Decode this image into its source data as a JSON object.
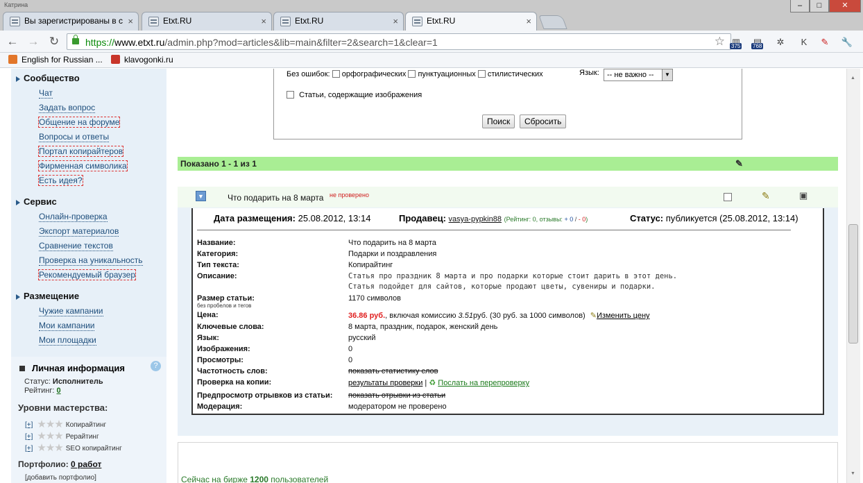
{
  "browser": {
    "window_label": "Катрина",
    "tabs": [
      {
        "title": "Вы зарегистрированы в с",
        "active": false
      },
      {
        "title": "Etxt.RU",
        "active": false
      },
      {
        "title": "Etxt.RU",
        "active": false
      },
      {
        "title": "Etxt.RU",
        "active": true
      }
    ],
    "tab_close": "×",
    "url_https": "https://",
    "url_host": "www.etxt.ru",
    "url_path": "/admin.php?mod=articles&lib=main&filter=2&search=1&clear=1",
    "ext_badges": [
      "375",
      "768"
    ],
    "bookmarks": [
      "English for Russian ...",
      "klavogonki.ru"
    ],
    "win_controls": [
      "–",
      "□",
      "✕"
    ]
  },
  "sidebar": {
    "community_title": "Сообщество",
    "community_links": [
      "Чат",
      "Задать вопрос",
      "Общение на форуме",
      "Вопросы и ответы",
      "Портал копирайтеров",
      "Фирменная символика",
      "Есть идея?"
    ],
    "service_title": "Сервис",
    "service_links": [
      "Онлайн-проверка",
      "Экспорт материалов",
      "Сравнение текстов",
      "Проверка на уникальность",
      "Рекомендуемый браузер"
    ],
    "placement_title": "Размещение",
    "placement_links": [
      "Чужие кампании",
      "Мои кампании",
      "Мои площадки"
    ],
    "personal": {
      "title": "Личная информация",
      "help": "?",
      "status_label": "Статус:",
      "status_value": "Исполнитель",
      "rating_label": "Рейтинг:",
      "rating_value": "0",
      "levels_title": "Уровни мастерства:",
      "levels": [
        {
          "plus": "[+]",
          "name": "Копирайтинг"
        },
        {
          "plus": "[+]",
          "name": "Рерайтинг"
        },
        {
          "plus": "[+]",
          "name": "SEO копирайтинг"
        }
      ],
      "portfolio_label": "Портфолио:",
      "portfolio_value": "0 работ",
      "add_portfolio": "[добавить портфолио]"
    }
  },
  "search": {
    "no_errors_label": "Без ошибок:",
    "check_spelling": "орфографических",
    "check_punct": "пунктуационных",
    "check_style": "стилистических",
    "lang_label": "Язык:",
    "lang_value": "-- не важно --",
    "images_check": "Статьи, содержащие изображения",
    "search_btn": "Поиск",
    "reset_btn": "Сбросить"
  },
  "results": {
    "shown": "Показано 1 - 1 из 1"
  },
  "article": {
    "title": "Что подарить на 8 марта",
    "not_checked": "не проверено",
    "date_label": "Дата размещения:",
    "date_value": "25.08.2012, 13:14",
    "seller_label": "Продавец:",
    "seller_name": "vasya-pypkin88",
    "seller_rating_open": "(Рейтинг: 0, отзывы: ",
    "seller_plus": "+ 0",
    "seller_sep": " / ",
    "seller_minus": "- 0",
    "seller_close": ")",
    "status_label": "Статус:",
    "status_value": "публикуется (25.08.2012, 13:14)",
    "fields": {
      "name_l": "Название:",
      "name_v": "Что подарить на 8 марта",
      "cat_l": "Категория:",
      "cat_v": "Подарки и поздравления",
      "type_l": "Тип текста:",
      "type_v": "Копирайтинг",
      "desc_l": "Описание:",
      "desc_v1": "Статья про праздник 8 марта и про подарки которые стоит дарить в этот день.",
      "desc_v2": "Статья подойдет для сайтов, которые продают цветы, сувениры и подарки.",
      "size_l": "Размер статьи:",
      "size_sub": "без пробелов и тегов",
      "size_v": "1170 символов",
      "price_l": "Цена:",
      "price_v": "36.86 руб.",
      "price_rest1": ", включая комиссию ",
      "price_comm": "3.51",
      "price_rest2": "руб. (30 руб. за 1000 символов)",
      "price_change": "Изменить цену",
      "kw_l": "Ключевые слова:",
      "kw_v": "8 марта, праздник, подарок, женский день",
      "lang_l": "Язык:",
      "lang_v": "русский",
      "img_l": "Изображения:",
      "img_v": "0",
      "views_l": "Просмотры:",
      "views_v": "0",
      "freq_l": "Частотность слов:",
      "freq_v": "показать статистику слов",
      "copy_l": "Проверка на копии:",
      "copy_v": "результаты проверки",
      "copy_sep": "|",
      "copy_resend": "Послать на перепроверку",
      "preview_l": "Предпросмотр отрывков из статьи:",
      "preview_v": "показать отрывки из статьи",
      "mod_l": "Модерация:",
      "mod_v": "модератором не проверено"
    }
  },
  "footer": {
    "online_text": "Сейчас на бирже",
    "online_count": "1200",
    "online_suffix": "пользователей"
  },
  "colors": {
    "green_bar": "#a9ee94",
    "sidebar_bg": "#e7f0f8",
    "price_red": "#e02020",
    "link_blue": "#1e4e7c"
  }
}
